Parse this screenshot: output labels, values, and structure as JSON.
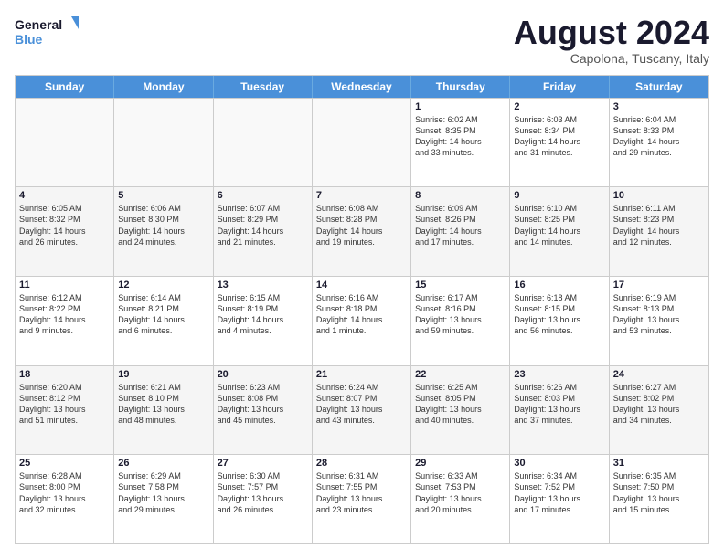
{
  "logo": {
    "line1": "General",
    "line2": "Blue"
  },
  "title": "August 2024",
  "location": "Capolona, Tuscany, Italy",
  "days_of_week": [
    "Sunday",
    "Monday",
    "Tuesday",
    "Wednesday",
    "Thursday",
    "Friday",
    "Saturday"
  ],
  "rows": [
    [
      {
        "day": "",
        "info": "",
        "empty": true
      },
      {
        "day": "",
        "info": "",
        "empty": true
      },
      {
        "day": "",
        "info": "",
        "empty": true
      },
      {
        "day": "",
        "info": "",
        "empty": true
      },
      {
        "day": "1",
        "info": "Sunrise: 6:02 AM\nSunset: 8:35 PM\nDaylight: 14 hours\nand 33 minutes."
      },
      {
        "day": "2",
        "info": "Sunrise: 6:03 AM\nSunset: 8:34 PM\nDaylight: 14 hours\nand 31 minutes."
      },
      {
        "day": "3",
        "info": "Sunrise: 6:04 AM\nSunset: 8:33 PM\nDaylight: 14 hours\nand 29 minutes."
      }
    ],
    [
      {
        "day": "4",
        "info": "Sunrise: 6:05 AM\nSunset: 8:32 PM\nDaylight: 14 hours\nand 26 minutes."
      },
      {
        "day": "5",
        "info": "Sunrise: 6:06 AM\nSunset: 8:30 PM\nDaylight: 14 hours\nand 24 minutes."
      },
      {
        "day": "6",
        "info": "Sunrise: 6:07 AM\nSunset: 8:29 PM\nDaylight: 14 hours\nand 21 minutes."
      },
      {
        "day": "7",
        "info": "Sunrise: 6:08 AM\nSunset: 8:28 PM\nDaylight: 14 hours\nand 19 minutes."
      },
      {
        "day": "8",
        "info": "Sunrise: 6:09 AM\nSunset: 8:26 PM\nDaylight: 14 hours\nand 17 minutes."
      },
      {
        "day": "9",
        "info": "Sunrise: 6:10 AM\nSunset: 8:25 PM\nDaylight: 14 hours\nand 14 minutes."
      },
      {
        "day": "10",
        "info": "Sunrise: 6:11 AM\nSunset: 8:23 PM\nDaylight: 14 hours\nand 12 minutes."
      }
    ],
    [
      {
        "day": "11",
        "info": "Sunrise: 6:12 AM\nSunset: 8:22 PM\nDaylight: 14 hours\nand 9 minutes."
      },
      {
        "day": "12",
        "info": "Sunrise: 6:14 AM\nSunset: 8:21 PM\nDaylight: 14 hours\nand 6 minutes."
      },
      {
        "day": "13",
        "info": "Sunrise: 6:15 AM\nSunset: 8:19 PM\nDaylight: 14 hours\nand 4 minutes."
      },
      {
        "day": "14",
        "info": "Sunrise: 6:16 AM\nSunset: 8:18 PM\nDaylight: 14 hours\nand 1 minute."
      },
      {
        "day": "15",
        "info": "Sunrise: 6:17 AM\nSunset: 8:16 PM\nDaylight: 13 hours\nand 59 minutes."
      },
      {
        "day": "16",
        "info": "Sunrise: 6:18 AM\nSunset: 8:15 PM\nDaylight: 13 hours\nand 56 minutes."
      },
      {
        "day": "17",
        "info": "Sunrise: 6:19 AM\nSunset: 8:13 PM\nDaylight: 13 hours\nand 53 minutes."
      }
    ],
    [
      {
        "day": "18",
        "info": "Sunrise: 6:20 AM\nSunset: 8:12 PM\nDaylight: 13 hours\nand 51 minutes."
      },
      {
        "day": "19",
        "info": "Sunrise: 6:21 AM\nSunset: 8:10 PM\nDaylight: 13 hours\nand 48 minutes."
      },
      {
        "day": "20",
        "info": "Sunrise: 6:23 AM\nSunset: 8:08 PM\nDaylight: 13 hours\nand 45 minutes."
      },
      {
        "day": "21",
        "info": "Sunrise: 6:24 AM\nSunset: 8:07 PM\nDaylight: 13 hours\nand 43 minutes."
      },
      {
        "day": "22",
        "info": "Sunrise: 6:25 AM\nSunset: 8:05 PM\nDaylight: 13 hours\nand 40 minutes."
      },
      {
        "day": "23",
        "info": "Sunrise: 6:26 AM\nSunset: 8:03 PM\nDaylight: 13 hours\nand 37 minutes."
      },
      {
        "day": "24",
        "info": "Sunrise: 6:27 AM\nSunset: 8:02 PM\nDaylight: 13 hours\nand 34 minutes."
      }
    ],
    [
      {
        "day": "25",
        "info": "Sunrise: 6:28 AM\nSunset: 8:00 PM\nDaylight: 13 hours\nand 32 minutes."
      },
      {
        "day": "26",
        "info": "Sunrise: 6:29 AM\nSunset: 7:58 PM\nDaylight: 13 hours\nand 29 minutes."
      },
      {
        "day": "27",
        "info": "Sunrise: 6:30 AM\nSunset: 7:57 PM\nDaylight: 13 hours\nand 26 minutes."
      },
      {
        "day": "28",
        "info": "Sunrise: 6:31 AM\nSunset: 7:55 PM\nDaylight: 13 hours\nand 23 minutes."
      },
      {
        "day": "29",
        "info": "Sunrise: 6:33 AM\nSunset: 7:53 PM\nDaylight: 13 hours\nand 20 minutes."
      },
      {
        "day": "30",
        "info": "Sunrise: 6:34 AM\nSunset: 7:52 PM\nDaylight: 13 hours\nand 17 minutes."
      },
      {
        "day": "31",
        "info": "Sunrise: 6:35 AM\nSunset: 7:50 PM\nDaylight: 13 hours\nand 15 minutes."
      }
    ]
  ]
}
